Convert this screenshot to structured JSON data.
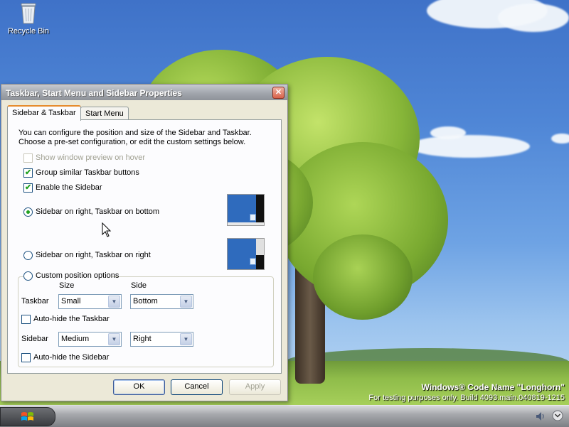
{
  "desktop": {
    "recycle_bin_label": "Recycle Bin",
    "watermark_line1": "Windows® Code Name \"Longhorn\"",
    "watermark_line2": "For testing purposes only. Build 4093.main.040819-1215"
  },
  "dialog": {
    "title": "Taskbar, Start Menu and Sidebar Properties",
    "close_glyph": "✕",
    "tabs": [
      {
        "label": "Sidebar & Taskbar",
        "selected": true
      },
      {
        "label": "Start Menu",
        "selected": false
      }
    ],
    "description": "You can configure the position and size of the Sidebar and Taskbar. Choose a pre-set configuration, or edit the custom settings below.",
    "options": {
      "show_preview": {
        "label": "Show window preview on hover",
        "checked": false,
        "enabled": false
      },
      "group_buttons": {
        "label": "Group similar Taskbar buttons",
        "checked": true
      },
      "enable_sidebar": {
        "label": "Enable the Sidebar",
        "checked": true
      }
    },
    "layouts": [
      {
        "label": "Sidebar on right, Taskbar on bottom",
        "selected": true
      },
      {
        "label": "Sidebar on right, Taskbar on right",
        "selected": false
      },
      {
        "label": "Custom position options",
        "selected": false
      }
    ],
    "custom": {
      "size_header": "Size",
      "side_header": "Side",
      "taskbar_label": "Taskbar",
      "taskbar_size": "Small",
      "taskbar_side": "Bottom",
      "autohide_taskbar": "Auto-hide the Taskbar",
      "sidebar_label": "Sidebar",
      "sidebar_size": "Medium",
      "sidebar_side": "Right",
      "autohide_sidebar": "Auto-hide the Sidebar"
    },
    "buttons": {
      "ok": "OK",
      "cancel": "Cancel",
      "apply": "Apply"
    },
    "check_glyph": "✔",
    "dropdown_glyph": "▼"
  },
  "icons": {
    "recycle_bin": "recycle-bin-icon",
    "start": "windows-logo-icon",
    "volume": "volume-icon",
    "tray_expand": "chevron-down-icon",
    "cursor": "mouse-pointer-icon"
  },
  "colors": {
    "tab_accent": "#e68b2c",
    "checkmark": "#21a121",
    "preview_desktop": "#2f6bbd"
  }
}
